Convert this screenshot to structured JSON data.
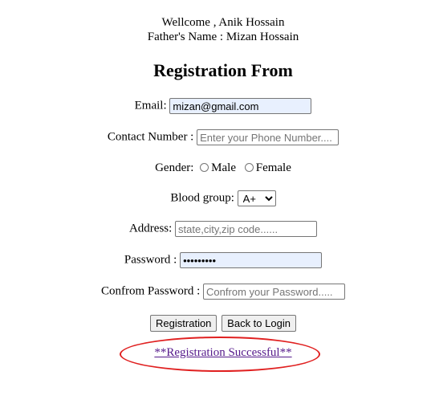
{
  "welcome": {
    "line1": "Wellcome , Anik Hossain",
    "line2": "Father's Name : Mizan Hossain"
  },
  "form": {
    "title": "Registration From",
    "email": {
      "label": "Email:",
      "value": "mizan@gmail.com"
    },
    "contact": {
      "label": "Contact Number :",
      "placeholder": "Enter your Phone Number...."
    },
    "gender": {
      "label": "Gender:",
      "options": [
        "Male",
        "Female"
      ]
    },
    "blood_group": {
      "label": "Blood group:",
      "selected": "A+"
    },
    "address": {
      "label": "Address:",
      "placeholder": "state,city,zip code......"
    },
    "password": {
      "label": "Password :",
      "value": "•••••••••"
    },
    "confirm_password": {
      "label": "Confrom Password :",
      "placeholder": "Confrom your Password....."
    },
    "buttons": {
      "register": "Registration",
      "back": "Back to Login"
    },
    "status": "**Registration Successful**"
  },
  "colors": {
    "autofill_bg": "#e8f0fe",
    "link_visited": "#551a8b",
    "highlight_ellipse": "#e02020"
  }
}
